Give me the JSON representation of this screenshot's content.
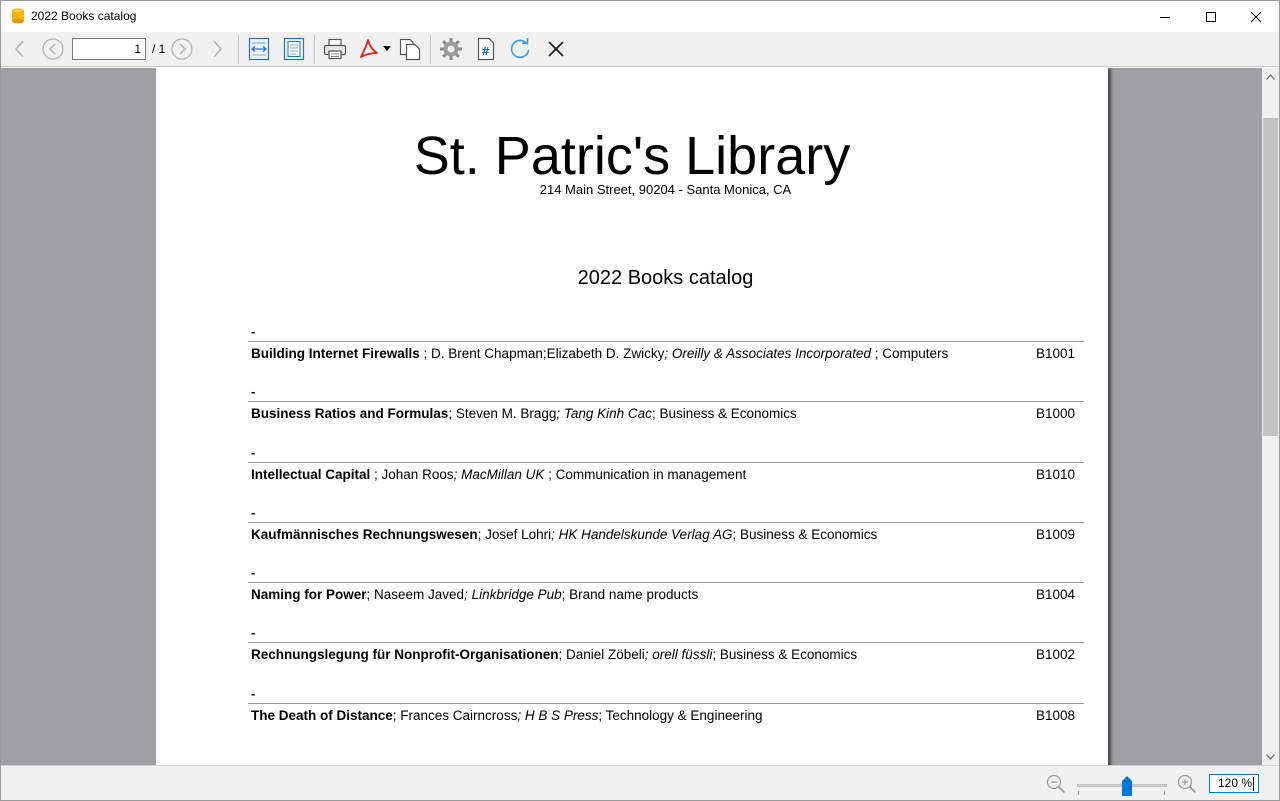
{
  "window": {
    "title": "2022 Books catalog"
  },
  "toolbar": {
    "page_value": "1",
    "page_total": "/ 1",
    "icons": [
      "chevron-left-icon",
      "circle-arrow-left-icon",
      "circle-arrow-right-icon",
      "chevron-right-icon",
      "fit-width-icon",
      "fit-page-icon",
      "print-icon",
      "pdf-export-icon",
      "copy-icon",
      "settings-icon",
      "page-number-icon",
      "refresh-icon",
      "close-icon"
    ]
  },
  "document": {
    "library_name": "St. Patric's Library",
    "library_address": "214 Main Street, 90204 - Santa Monica, CA",
    "catalog_title": "2022 Books catalog",
    "entries": [
      {
        "dash": "-",
        "title": "Building Internet Firewalls",
        "sep1": " ; D. Brent Chapman;Elizabeth D. Zwicky",
        "publisher": "; Oreilly & Associates Incorporated ",
        "category": "; Computers",
        "code": "B1001"
      },
      {
        "dash": "-",
        "title": "Business Ratios and Formulas",
        "sep1": "; Steven M. Bragg",
        "publisher": "; Tang Kinh Cac",
        "category": "; Business & Economics",
        "code": "B1000"
      },
      {
        "dash": "-",
        "title": "Intellectual Capital",
        "sep1": " ; Johan Roos",
        "publisher": "; MacMillan UK ",
        "category": "; Communication in management",
        "code": "B1010"
      },
      {
        "dash": "-",
        "title": "Kaufmännisches Rechnungswesen",
        "sep1": "; Josef Lohri",
        "publisher": "; HK Handelskunde Verlag AG",
        "category": "; Business & Economics",
        "code": "B1009"
      },
      {
        "dash": "-",
        "title": "Naming for Power",
        "sep1": "; Naseem Javed",
        "publisher": "; Linkbridge Pub",
        "category": "; Brand name products",
        "code": "B1004"
      },
      {
        "dash": "-",
        "title": "Rechnungslegung für Nonprofit-Organisationen",
        "sep1": "; Daniel Zöbeli",
        "publisher": "; orell füssli",
        "category": "; Business & Economics",
        "code": "B1002"
      },
      {
        "dash": "-",
        "title": "The Death of Distance",
        "sep1": "; Frances Cairncross",
        "publisher": "; H B S Press",
        "category": "; Technology & Engineering",
        "code": "B1008"
      }
    ]
  },
  "statusbar": {
    "zoom_level": "120 %",
    "zoom_slider_fraction": 0.6
  },
  "colors": {
    "accent": "#0078d7",
    "viewer_background": "#a0a0a4",
    "pdf_red": "#d8231c"
  }
}
